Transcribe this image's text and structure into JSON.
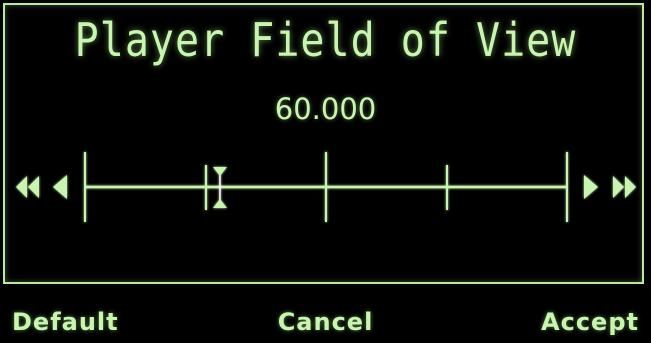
{
  "dialog": {
    "title": "Player Field of View",
    "value_text": "60.000",
    "slider_fraction": 0.28
  },
  "buttons": {
    "default_label": "Default",
    "cancel_label": "Cancel",
    "accept_label": "Accept"
  },
  "colors": {
    "accent": "#c8f5b0",
    "border": "#b9e8a0",
    "background": "#000000"
  },
  "icons": {
    "step_left_fast": "double-left-arrow-icon",
    "step_left": "left-arrow-icon",
    "step_right": "right-arrow-icon",
    "step_right_fast": "double-right-arrow-icon",
    "thumb": "slider-thumb-icon"
  }
}
